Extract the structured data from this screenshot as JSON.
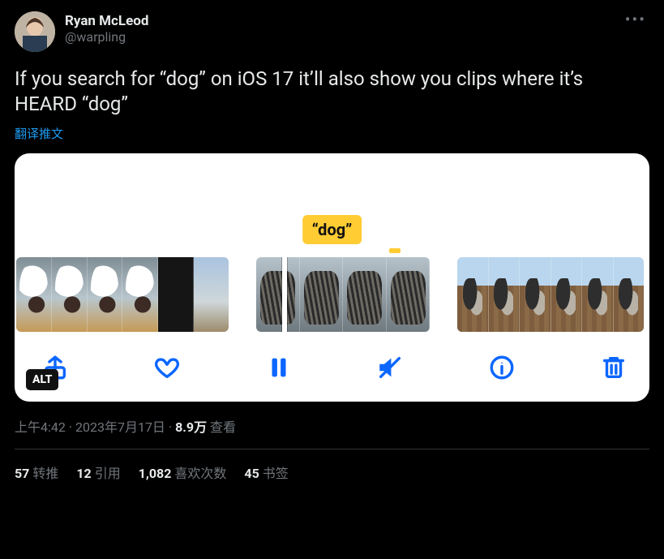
{
  "author": {
    "display_name": "Ryan McLeod",
    "handle": "@warpling"
  },
  "tweet_text": "If you search for “dog” on iOS 17 it’ll also show you clips where it’s HEARD “dog”",
  "translate_label": "翻译推文",
  "media": {
    "bubble": "“dog”",
    "alt_badge": "ALT"
  },
  "meta": {
    "time": "上午4:42",
    "date": "2023年7月17日",
    "views_count": "8.9万",
    "views_label": "查看",
    "separator": " · "
  },
  "stats": {
    "retweets": {
      "count": "57",
      "label": "转推"
    },
    "quotes": {
      "count": "12",
      "label": "引用"
    },
    "likes": {
      "count": "1,082",
      "label": "喜欢次数"
    },
    "bookmarks": {
      "count": "45",
      "label": "书签"
    }
  }
}
